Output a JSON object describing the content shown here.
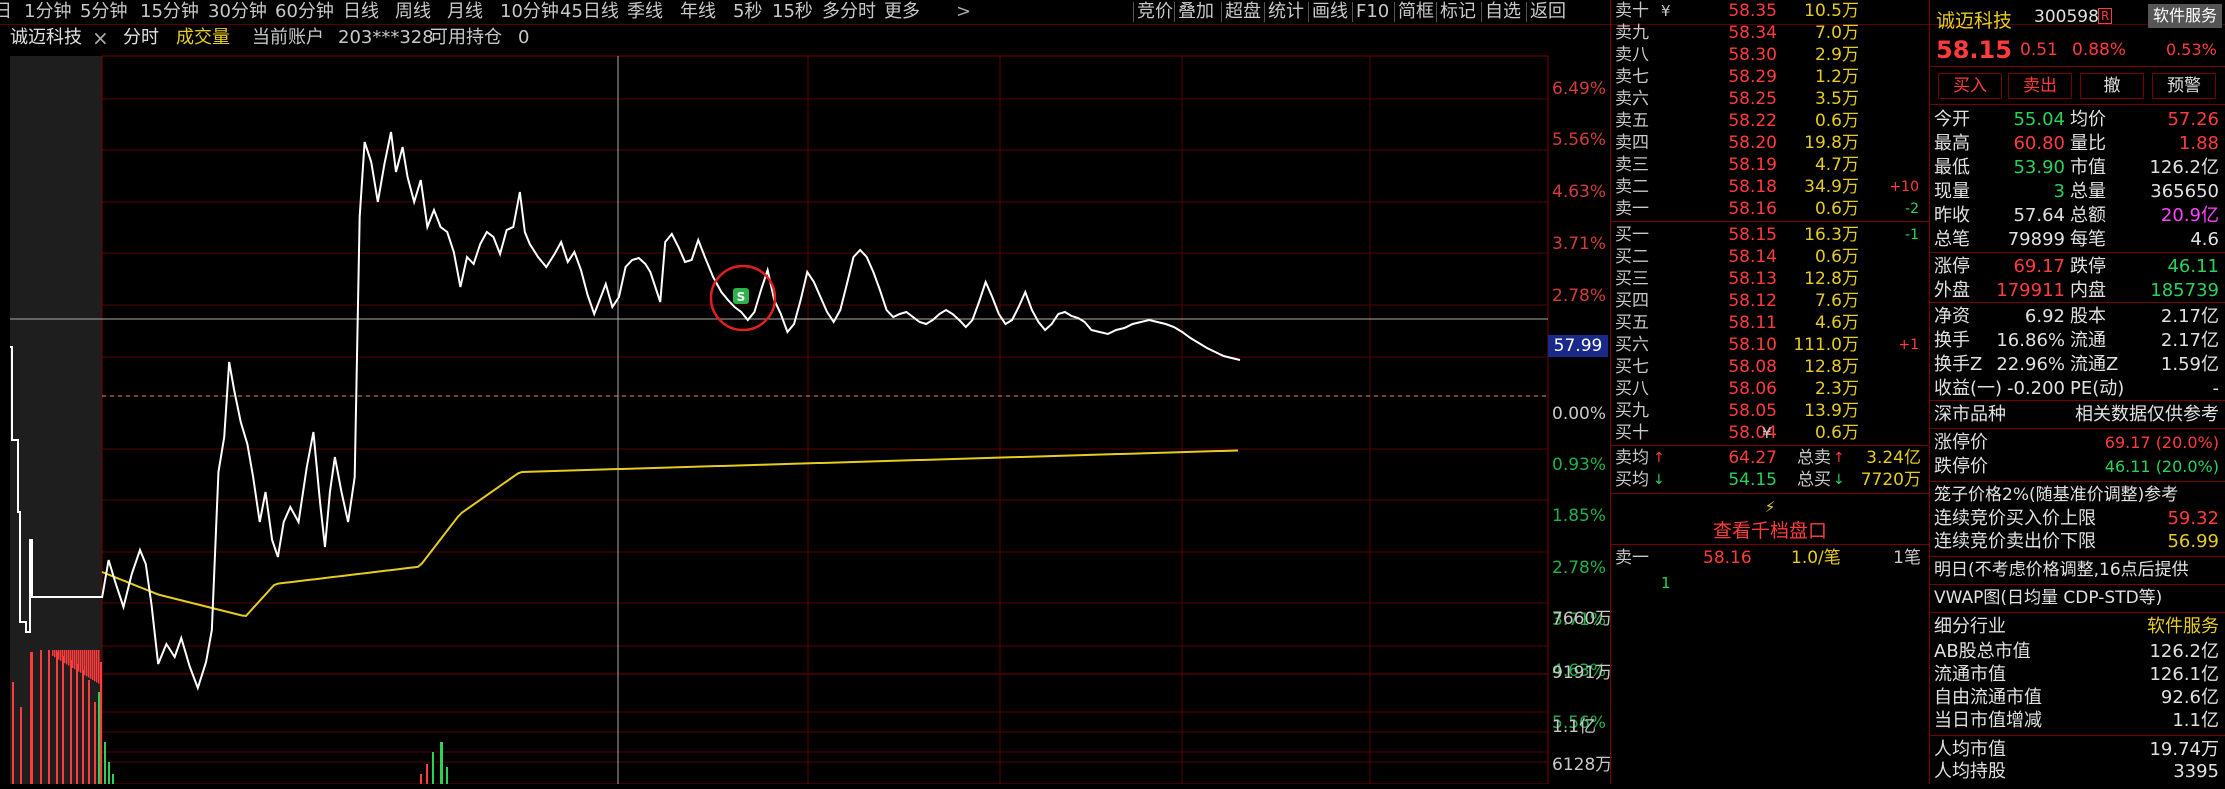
{
  "topbar": {
    "periods": [
      "日",
      "1分钟",
      "5分钟",
      "15分钟",
      "30分钟",
      "60分钟",
      "日线",
      "周线",
      "月线",
      "10分钟",
      "45日线",
      "季线",
      "年线",
      "5秒",
      "15秒",
      "多分时",
      "更多"
    ],
    "more_arrow": ">",
    "tools": [
      "竞价",
      "叠加",
      "超盘",
      "统计",
      "画线",
      "F10",
      "简框",
      "标记",
      "自选",
      "返回"
    ]
  },
  "infobar": {
    "stock_name": "诚迈科技",
    "mode": "分时",
    "indicator": "成交量",
    "account_label": "当前账户",
    "account_id": "203***328",
    "holding_label": "可用持仓",
    "holding_value": "0",
    "close_icon": "×"
  },
  "chart": {
    "price_axis_labels": [
      "6.49%",
      "5.56%",
      "4.63%",
      "3.71%",
      "2.78%",
      "1.85%",
      "0.00%",
      "0.93%",
      "1.85%",
      "2.78%",
      "3.71%",
      "4.63%",
      "5.56%"
    ],
    "cursor_price": "57.99",
    "volume_axis_labels": [
      "1.1亿",
      "9191万",
      "7660万",
      "6128万"
    ],
    "marker_label": "S",
    "colors": {
      "price_line": "#ffffff",
      "avg_line": "#e6cc1e",
      "up": "#ff3b3b",
      "down": "#29d35a",
      "grid": "#7a0000"
    }
  },
  "book": {
    "asks": [
      {
        "label": "卖十",
        "price": "58.35",
        "vol": "10.5万",
        "chg": ""
      },
      {
        "label": "卖九",
        "price": "58.34",
        "vol": "7.0万",
        "chg": ""
      },
      {
        "label": "卖八",
        "price": "58.30",
        "vol": "2.9万",
        "chg": ""
      },
      {
        "label": "卖七",
        "price": "58.29",
        "vol": "1.2万",
        "chg": ""
      },
      {
        "label": "卖六",
        "price": "58.25",
        "vol": "3.5万",
        "chg": ""
      },
      {
        "label": "卖五",
        "price": "58.22",
        "vol": "0.6万",
        "chg": ""
      },
      {
        "label": "卖四",
        "price": "58.20",
        "vol": "19.8万",
        "chg": ""
      },
      {
        "label": "卖三",
        "price": "58.19",
        "vol": "4.7万",
        "chg": ""
      },
      {
        "label": "卖二",
        "price": "58.18",
        "vol": "34.9万",
        "chg": "+10"
      },
      {
        "label": "卖一",
        "price": "58.16",
        "vol": "0.6万",
        "chg": "-2"
      }
    ],
    "top_ask_suffix": "¥",
    "bids": [
      {
        "label": "买一",
        "price": "58.15",
        "vol": "16.3万",
        "chg": "-1"
      },
      {
        "label": "买二",
        "price": "58.14",
        "vol": "0.6万",
        "chg": ""
      },
      {
        "label": "买三",
        "price": "58.13",
        "vol": "12.8万",
        "chg": ""
      },
      {
        "label": "买四",
        "price": "58.12",
        "vol": "7.6万",
        "chg": ""
      },
      {
        "label": "买五",
        "price": "58.11",
        "vol": "4.6万",
        "chg": ""
      },
      {
        "label": "买六",
        "price": "58.10",
        "vol": "111.0万",
        "chg": "+1"
      },
      {
        "label": "买七",
        "price": "58.08",
        "vol": "12.8万",
        "chg": ""
      },
      {
        "label": "买八",
        "price": "58.06",
        "vol": "2.3万",
        "chg": ""
      },
      {
        "label": "买九",
        "price": "58.05",
        "vol": "13.9万",
        "chg": ""
      },
      {
        "label": "买十",
        "price": "58.04",
        "vol": "0.6万",
        "chg": ""
      }
    ],
    "last_bid_suffix": "¥",
    "ask_avg_label": "卖均",
    "ask_avg": "64.27",
    "ask_total_label": "总卖",
    "ask_total": "3.24亿",
    "bid_avg_label": "买均",
    "bid_avg": "54.15",
    "bid_total_label": "总买",
    "bid_total": "7720万",
    "depth_link": "查看千档盘口",
    "queue_label": "卖一",
    "queue_price": "58.16",
    "queue_vol": "1.0/笔",
    "queue_count": "1笔",
    "queue_item": "1"
  },
  "quote": {
    "name": "诚迈科技",
    "code": "300598",
    "badge": "R",
    "sector_btn": "软件服务",
    "price": "58.15",
    "change": "0.51",
    "pct": "0.88%",
    "sector_pct": "0.53%",
    "buttons": [
      "买入",
      "卖出",
      "撤",
      "预警"
    ],
    "stats": [
      {
        "l1": "今开",
        "v1": "55.04",
        "c1": "green",
        "l2": "均价",
        "v2": "57.26",
        "c2": "red"
      },
      {
        "l1": "最高",
        "v1": "60.80",
        "c1": "red",
        "l2": "量比",
        "v2": "1.88",
        "c2": "red"
      },
      {
        "l1": "最低",
        "v1": "53.90",
        "c1": "green",
        "l2": "市值",
        "v2": "126.2亿",
        "c2": "white"
      },
      {
        "l1": "现量",
        "v1": "3",
        "c1": "green",
        "l2": "总量",
        "v2": "365650",
        "c2": "white"
      },
      {
        "l1": "昨收",
        "v1": "57.64",
        "c1": "white",
        "l2": "总额",
        "v2": "20.9亿",
        "c2": "magenta"
      },
      {
        "l1": "总笔",
        "v1": "79899",
        "c1": "white",
        "l2": "每笔",
        "v2": "4.6",
        "c2": "white"
      }
    ],
    "limits": [
      {
        "l1": "涨停",
        "v1": "69.17",
        "c1": "red",
        "l2": "跌停",
        "v2": "46.11",
        "c2": "green"
      },
      {
        "l1": "外盘",
        "v1": "179911",
        "c1": "red",
        "l2": "内盘",
        "v2": "185739",
        "c2": "green"
      }
    ],
    "shares": [
      {
        "l1": "净资",
        "v1": "6.92",
        "l2": "股本",
        "v2": "2.17亿"
      },
      {
        "l1": "换手",
        "v1": "16.86%",
        "l2": "流通",
        "v2": "2.17亿"
      },
      {
        "l1": "换手Z",
        "v1": "22.96%",
        "l2": "流通Z",
        "v2": "1.59亿"
      },
      {
        "l1": "收益(一)",
        "v1": "-0.200",
        "l2": "PE(动)",
        "v2": "-"
      }
    ],
    "market_label": "深市品种",
    "market_note": "相关数据仅供参考",
    "limit_up_label": "涨停价",
    "limit_up": "69.17 (20.0%)",
    "limit_down_label": "跌停价",
    "limit_down": "46.11 (20.0%)",
    "cage_label": "笼子价格2%(随基准价调整)参考",
    "cage_up_label": "连续竞价买入价上限",
    "cage_up": "59.32",
    "cage_down_label": "连续竞价卖出价下限",
    "cage_down": "56.99",
    "tomorrow_note": "明日(不考虑价格调整,16点后提供",
    "vwap_note": "VWAP图(日均量 CDP-STD等)",
    "industry_label": "细分行业",
    "industry": "软件服务",
    "caps": [
      {
        "l": "AB股总市值",
        "v": "126.2亿"
      },
      {
        "l": "流通市值",
        "v": "126.1亿"
      },
      {
        "l": "自由流通市值",
        "v": "92.6亿"
      },
      {
        "l": "当日市值增减",
        "v": "1.1亿"
      }
    ],
    "per_capita": [
      {
        "l": "人均市值",
        "v": "19.74万"
      },
      {
        "l": "人均持股",
        "v": "3395"
      }
    ]
  }
}
